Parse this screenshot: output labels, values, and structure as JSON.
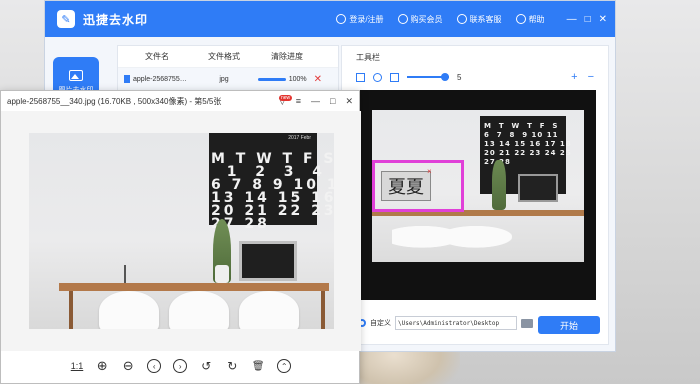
{
  "app": {
    "name": "迅捷去水印",
    "logo_glyph": "✎",
    "title_actions": [
      {
        "label": "登录/注册",
        "icon": "user-icon"
      },
      {
        "label": "购买会员",
        "icon": "vip-icon"
      },
      {
        "label": "联系客服",
        "icon": "service-icon"
      },
      {
        "label": "帮助",
        "icon": "help-icon"
      }
    ],
    "window_controls": [
      "—",
      "□",
      "✕"
    ],
    "brand_color": "#2f7cf6"
  },
  "sidebar": {
    "item_label": "图片去水印"
  },
  "file_list": {
    "headers": [
      "文件名",
      "文件格式",
      "清除进度"
    ],
    "rows": [
      {
        "name": "apple-2568755…",
        "format": "jpg",
        "progress_text": "100%",
        "progress": 1.0
      }
    ]
  },
  "toolbar": {
    "title": "工具栏",
    "brush_size": "5",
    "zoom_in": "+",
    "zoom_out": "−"
  },
  "preview": {
    "watermark_text": "夏夏",
    "watermark_delete": "×",
    "calendar_text": "M  T  W  T  F  S\n6  7  8  9 10 11\n13 14 15 16 17 18\n20 21 22 23 24 25\n27 28"
  },
  "output": {
    "mode_label": "自定义",
    "path": "\\Users\\Administrator\\Desktop",
    "start_label": "开始"
  },
  "viewer": {
    "title": "apple-2568755__340.jpg (16.70KB , 500x340像素) - 第5/5张",
    "controls": [
      "▽",
      "≡",
      "—",
      "□",
      "✕"
    ],
    "calendar_year": "2017 Febr",
    "calendar_text": "M T W T F S\n  1  2  3  4\n6 7 8 9 10 11\n13 14 15 16 17 18\n20 21 22 23 24 25\n27 28",
    "toolbar": {
      "ratio_label": "1:1",
      "zoom_in": "⊕",
      "zoom_out": "⊖",
      "prev": "‹",
      "next": "›",
      "rotate_left": "↺",
      "rotate_right": "↻",
      "delete": "🗑",
      "more": "⌃",
      "new_badge": "new"
    }
  }
}
